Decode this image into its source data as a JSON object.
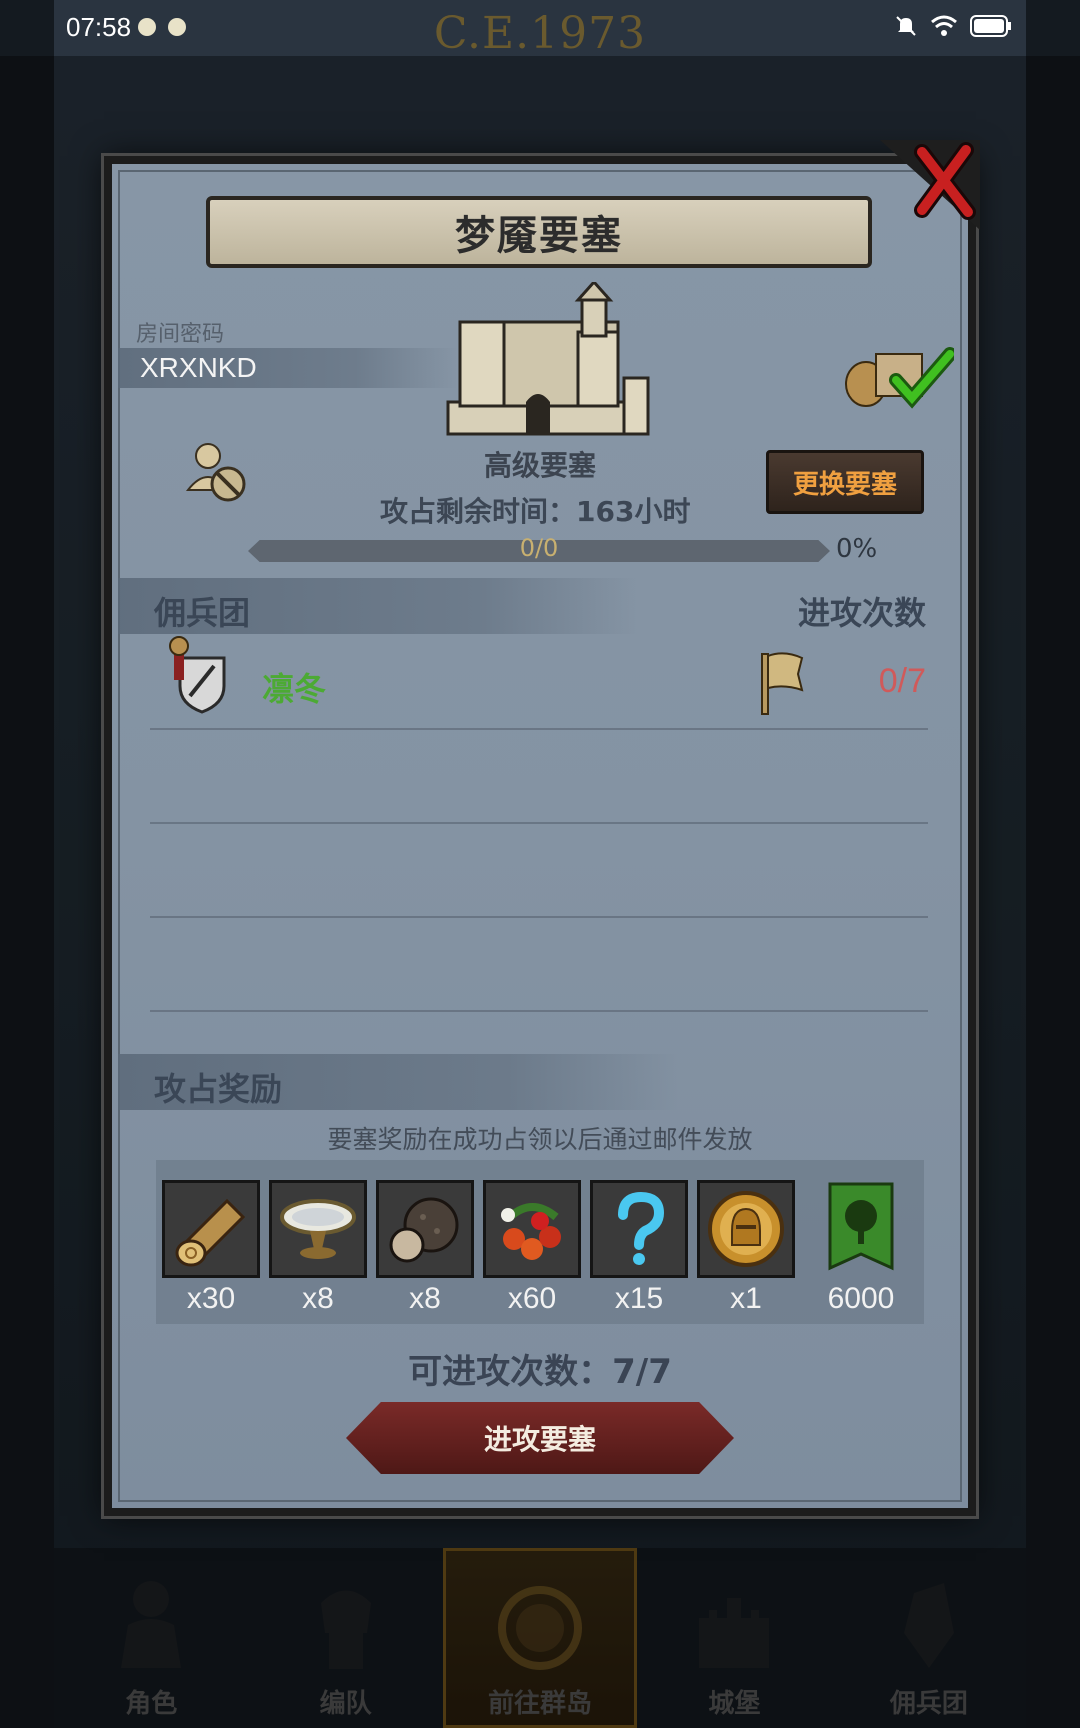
{
  "status_bar": {
    "time": "07:58"
  },
  "background": {
    "era_label": "C.E.1973"
  },
  "dialog": {
    "title": "梦魇要塞",
    "room_code_label": "房间密码",
    "room_code": "XRXNKD",
    "fortress_level": "高级要塞",
    "change_fortress_button": "更换要塞",
    "time_remaining": "攻占剩余时间：163小时",
    "progress": {
      "text": "0/0",
      "percent": "0%",
      "fraction": 0
    },
    "mercenary_header": "佣兵团",
    "attack_count_header": "进攻次数",
    "guilds": [
      {
        "name": "凛冬",
        "attacks": "0/7"
      }
    ],
    "rewards_header": "攻占奖励",
    "rewards_note": "要塞奖励在成功占领以后通过邮件发放",
    "rewards": [
      {
        "icon": "wood-log-icon",
        "qty": "x30"
      },
      {
        "icon": "silver-bowl-icon",
        "qty": "x8"
      },
      {
        "icon": "truffle-icon",
        "qty": "x8"
      },
      {
        "icon": "berries-icon",
        "qty": "x60"
      },
      {
        "icon": "mystery-question-icon",
        "qty": "x15"
      },
      {
        "icon": "knight-helmet-coin-icon",
        "qty": "x1"
      },
      {
        "icon": "tree-banner-icon",
        "qty": "6000"
      }
    ],
    "attacks_available": "可进攻次数：7/7",
    "attack_button": "进攻要塞"
  },
  "bottom_nav": [
    {
      "label": "角色",
      "icon": "character-icon",
      "active": false
    },
    {
      "label": "编队",
      "icon": "formation-icon",
      "active": false
    },
    {
      "label": "前往群岛",
      "icon": "islands-icon",
      "active": true
    },
    {
      "label": "城堡",
      "icon": "castle-icon",
      "active": false
    },
    {
      "label": "佣兵团",
      "icon": "mercenary-icon",
      "active": false
    }
  ]
}
